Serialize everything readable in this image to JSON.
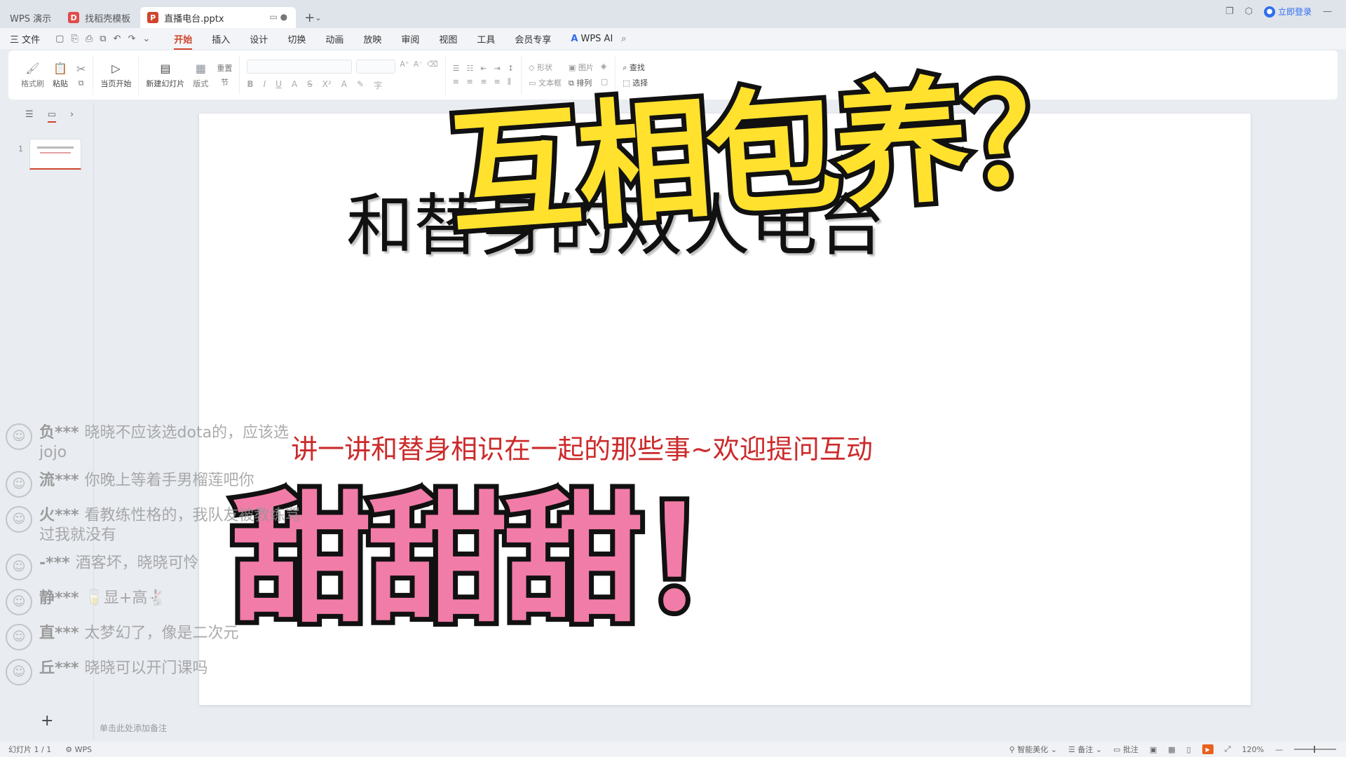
{
  "tabs": [
    {
      "label": "WPS 演示",
      "active": false
    },
    {
      "label": "找稻壳模板",
      "active": false,
      "icon": "wps-docer-icon",
      "color": "#e14b4b"
    },
    {
      "label": "直播电台.pptx",
      "active": true,
      "icon": "ppt-file-icon",
      "color": "#d0452d"
    }
  ],
  "window": {
    "login": "立即登录"
  },
  "menu": {
    "file": "三 文件",
    "items": [
      "开始",
      "插入",
      "设计",
      "切换",
      "动画",
      "放映",
      "审阅",
      "视图",
      "工具",
      "会员专享"
    ],
    "active": "开始",
    "ai": "WPS AI"
  },
  "ribbon": {
    "format_painter": "格式刷",
    "paste": "粘贴",
    "play_from_current": "当页开始",
    "new_slide": "新建幻灯片",
    "layout": "版式",
    "section": "节",
    "reset": "重置",
    "shape": "形状",
    "picture": "图片",
    "textbox": "文本框",
    "arrange": "排列",
    "find": "查找",
    "select": "选择"
  },
  "slide": {
    "sticker_top": "互相包养？",
    "headline": "和替身的双人电台",
    "subtitle": "讲一讲和替身相识在一起的那些事~欢迎提问互动",
    "sticker_bottom": "甜甜甜！"
  },
  "thumbnail": {
    "number": "1"
  },
  "notes_placeholder": "单击此处添加备注",
  "chat": [
    {
      "name": "负***",
      "text": "晓晓不应该选dota的，应该选jojo"
    },
    {
      "name": "流***",
      "text": "你晚上等着手男榴莲吧你"
    },
    {
      "name": "火***",
      "text": "看教练性格的，我队友被教练骂过我就没有"
    },
    {
      "name": "-***",
      "text": "酒客坏，晓晓可怜"
    },
    {
      "name": "静***",
      "text": "🥛显+高🐇"
    },
    {
      "name": "直***",
      "text": "太梦幻了，像是二次元"
    },
    {
      "name": "丘***",
      "text": "晓晓可以开门课吗"
    }
  ],
  "status": {
    "slide_counter": "幻灯片 1 / 1",
    "theme": "WPS",
    "beautify": "智能美化",
    "notes": "备注",
    "comments": "批注",
    "zoom": "120%"
  }
}
